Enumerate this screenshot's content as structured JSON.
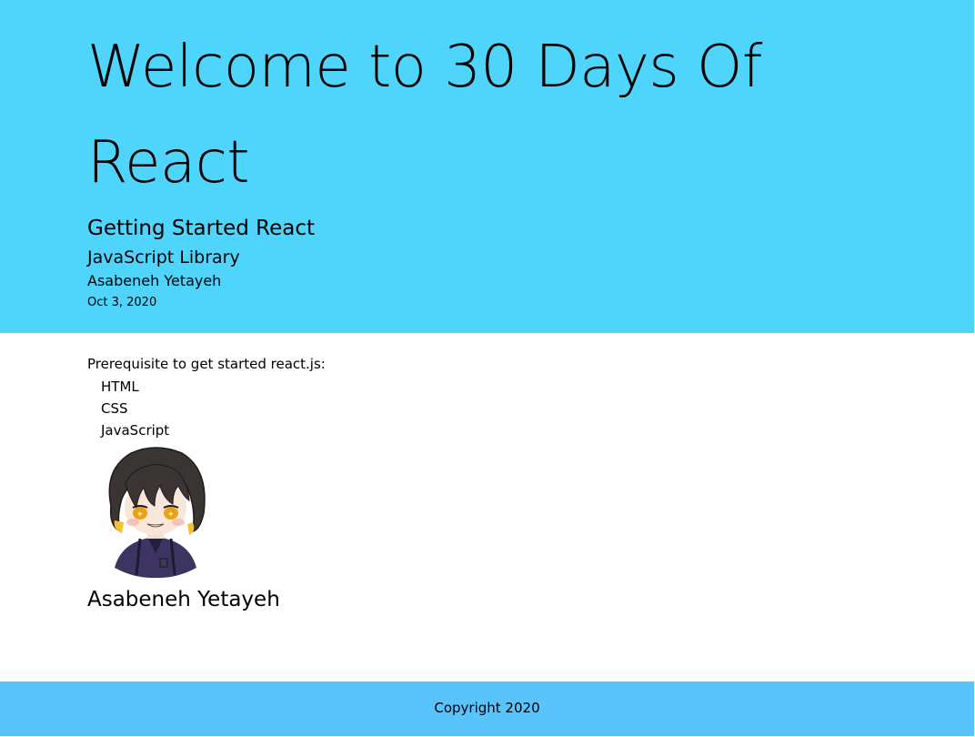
{
  "header": {
    "title": "Welcome to 30 Days Of React",
    "subtitle": "Getting Started React",
    "library": "JavaScript Library",
    "author": "Asabeneh Yetayeh",
    "date": "Oct 3, 2020",
    "background_color": "#4fd5fb"
  },
  "main": {
    "prerequisite_title": "Prerequisite to get started react.js:",
    "techs": [
      "HTML",
      "CSS",
      "JavaScript"
    ],
    "avatar_icon": "anime-avatar-illustration",
    "user_name": "Asabeneh Yetayeh"
  },
  "footer": {
    "copyright": "Copyright 2020",
    "background_color": "#5ac3fc"
  }
}
